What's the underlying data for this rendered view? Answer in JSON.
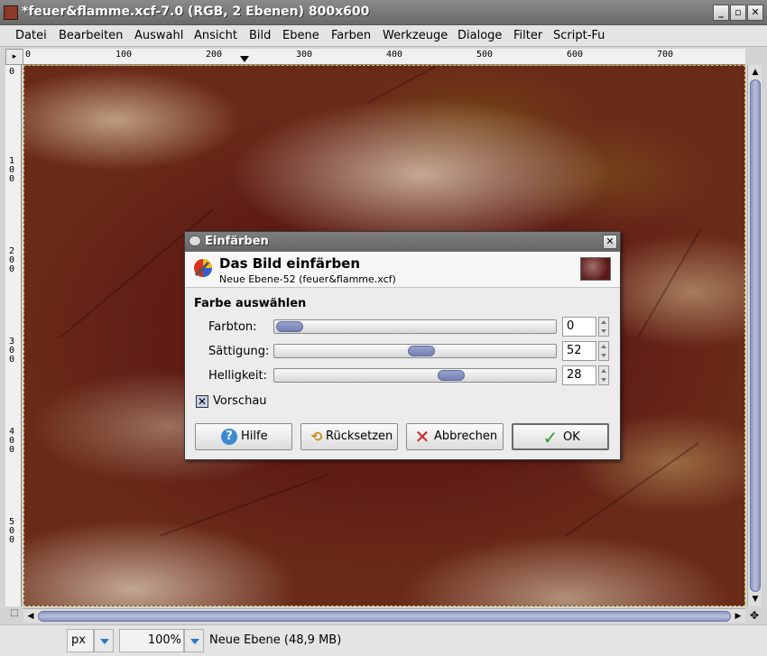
{
  "window": {
    "title": "*feuer&flamme.xcf-7.0 (RGB, 2 Ebenen) 800x600",
    "minimize_glyph": "_",
    "maximize_glyph": "▫",
    "close_glyph": "✕"
  },
  "menu": {
    "items": [
      "Datei",
      "Bearbeiten",
      "Auswahl",
      "Ansicht",
      "Bild",
      "Ebene",
      "Farben",
      "Werkzeuge",
      "Dialoge",
      "Filter",
      "Script-Fu"
    ]
  },
  "ruler": {
    "top_labels": [
      "0",
      "100",
      "200",
      "300",
      "400",
      "500",
      "600",
      "700"
    ],
    "left_labels": [
      "1\n0\n0",
      "2\n0\n0",
      "3\n0\n0",
      "4\n0\n0",
      "5\n0\n0"
    ],
    "left_zero": "0",
    "corner_glyph": "▸"
  },
  "status": {
    "unit": "px",
    "zoom": "100%",
    "message": "Neue Ebene (48,9 MB)"
  },
  "dialog": {
    "title": "Einfärben",
    "header_title": "Das Bild einfärben",
    "header_subtitle": "Neue Ebene-52 (feuer&flamme.xcf)",
    "section_title": "Farbe auswählen",
    "sliders": [
      {
        "label": "Farbton:",
        "value": "0",
        "level": 0.0
      },
      {
        "label": "Sättigung:",
        "value": "52",
        "level": 0.52
      },
      {
        "label": "Helligkeit:",
        "value": "28",
        "level": 0.64
      }
    ],
    "preview_label": "Vorschau",
    "preview_checked_glyph": "✕",
    "buttons": {
      "help": "Hilfe",
      "reset": "Rücksetzen",
      "cancel": "Abbrechen",
      "ok": "OK"
    },
    "close_glyph": "✕"
  },
  "colors": {
    "knob": "#7c88bc",
    "canvas_base": "#5e1c15"
  }
}
